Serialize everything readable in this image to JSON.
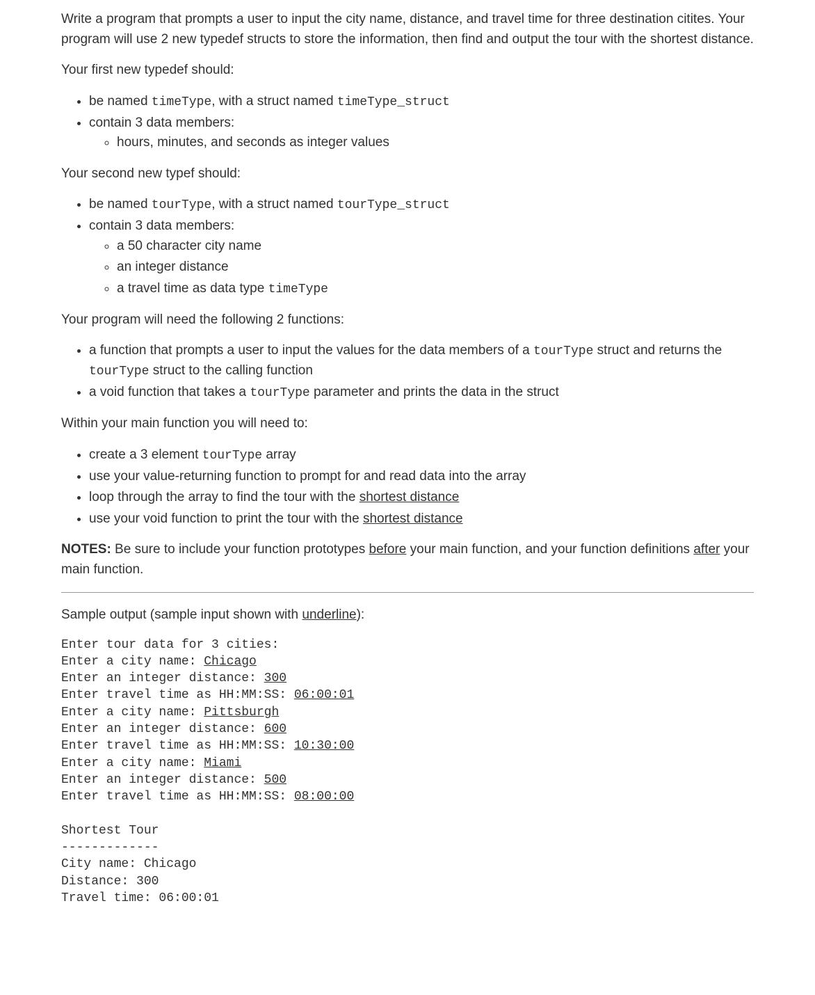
{
  "intro": "Write a program that prompts a user to input the city name, distance, and travel time for three destination citites. Your program will use 2 new typedef structs to store the information, then find and output the tour with the shortest distance.",
  "typedef1": {
    "heading": "Your first new typedef should:",
    "item1_pre": "be named ",
    "item1_code1": "timeType",
    "item1_mid": ", with a struct named ",
    "item1_code2": "timeType_struct",
    "item2": "contain 3 data members:",
    "sub1": "hours, minutes, and seconds as integer values"
  },
  "typedef2": {
    "heading": "Your second new typef should:",
    "item1_pre": "be named ",
    "item1_code1": "tourType",
    "item1_mid": ", with a struct named ",
    "item1_code2": "tourType_struct",
    "item2": "contain 3 data members:",
    "sub1": "a 50 character city name",
    "sub2": "an integer distance",
    "sub3_pre": "a travel time as data type ",
    "sub3_code": "timeType"
  },
  "functions": {
    "heading": "Your program will need the following 2 functions:",
    "item1_pre": "a function that prompts a user to input the values for the data members of a ",
    "item1_code1": "tourType",
    "item1_mid": " struct and returns the ",
    "item1_code2": "tourType",
    "item1_post": " struct to the calling function",
    "item2_pre": "a void function that takes a ",
    "item2_code": "tourType",
    "item2_post": " parameter and prints the data in the struct"
  },
  "main": {
    "heading": "Within your main function you will need to:",
    "item1_pre": "create a 3 element ",
    "item1_code": "tourType",
    "item1_post": " array",
    "item2": "use your value-returning function to prompt for and read data into the array",
    "item3_pre": "loop through the array to find the tour with the ",
    "item3_u": "shortest distance",
    "item4_pre": "use your void function to print the tour with the ",
    "item4_u": "shortest distance"
  },
  "notes": {
    "label": "NOTES:",
    "pre": " Be sure to include your function prototypes ",
    "u1": "before",
    "mid": " your main function, and your function definitions ",
    "u2": "after",
    "post": " your main function."
  },
  "sample": {
    "heading_pre": "Sample output (sample input shown with ",
    "heading_u": "underline",
    "heading_post": "):",
    "lines": {
      "l1": "Enter tour data for 3 cities:",
      "l2_pre": "Enter a city name: ",
      "l2_u": "Chicago",
      "l3_pre": "Enter an integer distance: ",
      "l3_u": "300",
      "l4_pre": "Enter travel time as HH:MM:SS: ",
      "l4_u": "06:00:01",
      "l5_pre": "Enter a city name: ",
      "l5_u": "Pittsburgh",
      "l6_pre": "Enter an integer distance: ",
      "l6_u": "600",
      "l7_pre": "Enter travel time as HH:MM:SS: ",
      "l7_u": "10:30:00",
      "l8_pre": "Enter a city name: ",
      "l8_u": "Miami",
      "l9_pre": "Enter an integer distance: ",
      "l9_u": "500",
      "l10_pre": "Enter travel time as HH:MM:SS: ",
      "l10_u": "08:00:00",
      "blank": "",
      "l11": "Shortest Tour",
      "l12": "-------------",
      "l13": "City name: Chicago",
      "l14": "Distance: 300",
      "l15": "Travel time: 06:00:01"
    }
  }
}
